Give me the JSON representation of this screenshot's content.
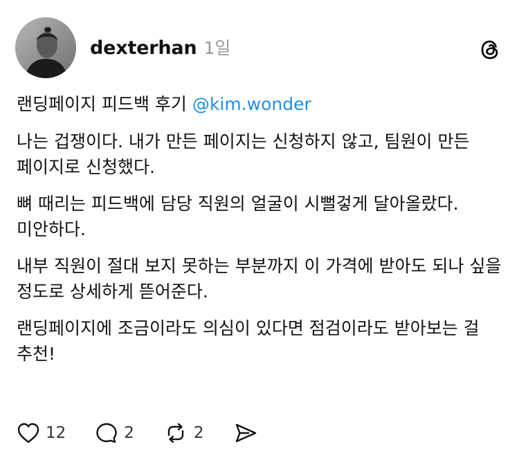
{
  "post": {
    "author": {
      "username": "dexterhan",
      "timestamp": "1일"
    },
    "title": "랜딩페이지 피드백 후기",
    "mention": "@kim.wonder",
    "paragraphs": [
      "나는 겁쟁이다. 내가 만든 페이지는 신청하지 않고, 팀원이 만든 페이지로 신청했다.",
      "뼈 때리는 피드백에 담당 직원의 얼굴이 시뻘겋게 달아올랐다. 미안하다.",
      "내부 직원이 절대 보지 못하는 부분까지 이 가격에 받아도 되나 싶을 정도로 상세하게 뜯어준다.",
      "랜딩페이지에 조금이라도 의심이 있다면 점검이라도 받아보는 걸 추천!"
    ],
    "actions": {
      "likes": "12",
      "replies": "2",
      "reposts": "2"
    }
  },
  "colors": {
    "mention": "#1d8fe6",
    "timestamp": "#9a9a9a",
    "text": "#111111"
  },
  "icons": {
    "logo": "threads-logo-icon",
    "like": "heart-icon",
    "reply": "comment-bubble-icon",
    "repost": "repost-icon",
    "share": "send-icon"
  }
}
